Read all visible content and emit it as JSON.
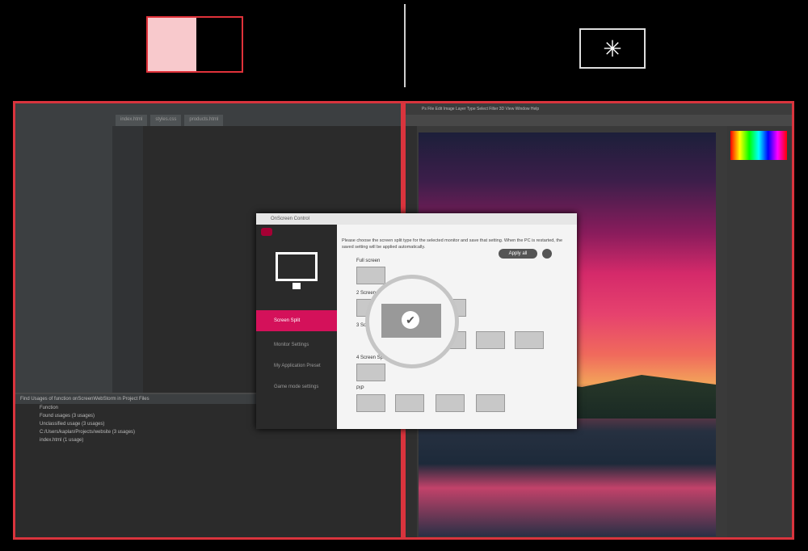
{
  "top_icons": {
    "split": "screen-split-icon",
    "brightness": "brightness-icon"
  },
  "dialog": {
    "title": "OnScreen Control",
    "info": "Please choose the screen split type for the selected monitor and save that setting. When the PC is restarted, the saved setting will be applied automatically.",
    "apply_label": "Apply all",
    "nav": [
      {
        "label": "Screen Split",
        "active": true
      },
      {
        "label": "Monitor Settings",
        "active": false
      },
      {
        "label": "My Application Preset",
        "active": false
      },
      {
        "label": "Game mode settings",
        "active": false
      }
    ],
    "sections": {
      "full": "Full screen",
      "two": "2 Screen Split",
      "three": "3 Screen Split",
      "four": "4 Screen Split",
      "pip": "PIP"
    }
  },
  "ide": {
    "tabs": [
      "index.html",
      "styles.css",
      "products.html"
    ],
    "find_header": "Find Usages of function onScreenWebStorm in Project Files",
    "find_rows": [
      "Function",
      "Found usages (3 usages)",
      "Unclassified usage (3 usages)",
      "C:/Users/kaplan/Projects/website (3 usages)",
      "index.html (1 usage)"
    ]
  },
  "photoshop": {
    "menus": "Ps  File  Edit  Image  Layer  Type  Select  Filter  3D  View  Window  Help"
  },
  "colors": {
    "accent": "#d9343d",
    "lg_magenta": "#d4115a"
  }
}
